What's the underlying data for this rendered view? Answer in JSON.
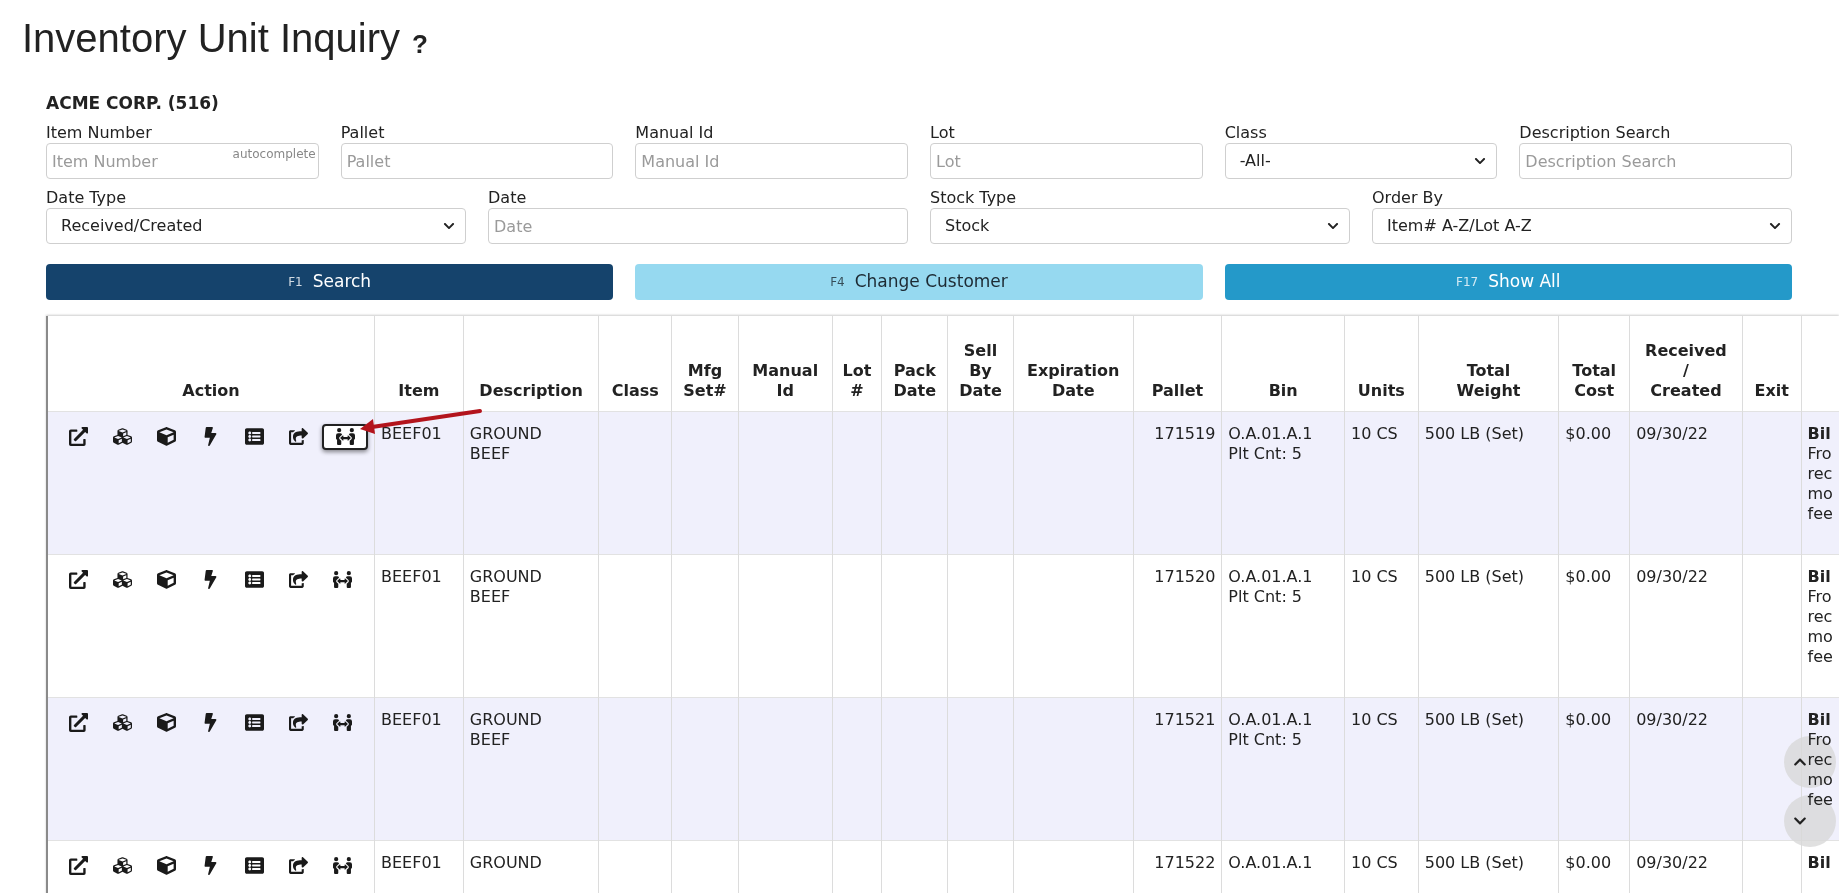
{
  "page": {
    "title": "Inventory Unit Inquiry",
    "help": "?"
  },
  "customer": "ACME CORP. (516)",
  "filters": [
    {
      "kind": "input",
      "label": "Item Number",
      "placeholder": "Item Number",
      "hint": "autocomplete"
    },
    {
      "kind": "input",
      "label": "Pallet",
      "placeholder": "Pallet"
    },
    {
      "kind": "input",
      "label": "Manual Id",
      "placeholder": "Manual Id"
    },
    {
      "kind": "input",
      "label": "Lot",
      "placeholder": "Lot"
    },
    {
      "kind": "select",
      "label": "Class",
      "value": "-All-"
    },
    {
      "kind": "input",
      "label": "Description Search",
      "placeholder": "Description Search"
    },
    {
      "kind": "select",
      "label": "Date Type",
      "value": "Received/Created"
    },
    {
      "kind": "input",
      "label": "Date",
      "placeholder": "Date"
    },
    {
      "kind": "select",
      "label": "Stock Type",
      "value": "Stock"
    },
    {
      "kind": "select",
      "label": "Order By",
      "value": "Item# A-Z/Lot A-Z"
    }
  ],
  "buttons": [
    {
      "key": "F1",
      "label": "Search"
    },
    {
      "key": "F4",
      "label": "Change Customer"
    },
    {
      "key": "F17",
      "label": "Show All"
    }
  ],
  "table": {
    "columns": [
      [
        "Action"
      ],
      [
        "Item"
      ],
      [
        "Description"
      ],
      [
        "Class"
      ],
      [
        "Mfg",
        "Set#"
      ],
      [
        "Manual",
        "Id"
      ],
      [
        "Lot",
        "#"
      ],
      [
        "Pack",
        "Date"
      ],
      [
        "Sell",
        "By",
        "Date"
      ],
      [
        "Expiration",
        "Date"
      ],
      [
        "Pallet"
      ],
      [
        "Bin"
      ],
      [
        "Units"
      ],
      [
        "Total",
        "Weight"
      ],
      [
        "Total",
        "Cost"
      ],
      [
        "Received",
        "/",
        "Created"
      ],
      [
        "Exit"
      ],
      []
    ],
    "rows": [
      {
        "actions": [
          {
            "kind": "open",
            "highlighted": false
          },
          {
            "kind": "cubes",
            "highlighted": false
          },
          {
            "kind": "cube",
            "highlighted": false
          },
          {
            "kind": "bolt",
            "highlighted": false
          },
          {
            "kind": "list",
            "highlighted": false
          },
          {
            "kind": "share",
            "highlighted": false
          },
          {
            "kind": "transfer",
            "highlighted": true
          }
        ],
        "item": "BEEF01",
        "description": [
          "GROUND",
          "BEEF"
        ],
        "pallet": "171519",
        "bin": [
          "O.A.01.A.1",
          "Plt Cnt: 5"
        ],
        "units": "10 CS",
        "total_weight": "500 LB (Set)",
        "total_cost": "$0.00",
        "received": "09/30/22",
        "note": {
          "title": "Bil",
          "lines": [
            "Fro",
            "rec",
            "mo",
            "fee"
          ]
        }
      },
      {
        "actions": [
          {
            "kind": "open",
            "highlighted": false
          },
          {
            "kind": "cubes",
            "highlighted": false
          },
          {
            "kind": "cube",
            "highlighted": false
          },
          {
            "kind": "bolt",
            "highlighted": false
          },
          {
            "kind": "list",
            "highlighted": false
          },
          {
            "kind": "share",
            "highlighted": false
          },
          {
            "kind": "transfer",
            "highlighted": false
          }
        ],
        "item": "BEEF01",
        "description": [
          "GROUND",
          "BEEF"
        ],
        "pallet": "171520",
        "bin": [
          "O.A.01.A.1",
          "Plt Cnt: 5"
        ],
        "units": "10 CS",
        "total_weight": "500 LB (Set)",
        "total_cost": "$0.00",
        "received": "09/30/22",
        "note": {
          "title": "Bil",
          "lines": [
            "Fro",
            "rec",
            "mo",
            "fee"
          ]
        }
      },
      {
        "actions": [
          {
            "kind": "open",
            "highlighted": false
          },
          {
            "kind": "cubes",
            "highlighted": false
          },
          {
            "kind": "cube",
            "highlighted": false
          },
          {
            "kind": "bolt",
            "highlighted": false
          },
          {
            "kind": "list",
            "highlighted": false
          },
          {
            "kind": "share",
            "highlighted": false
          },
          {
            "kind": "transfer",
            "highlighted": false
          }
        ],
        "item": "BEEF01",
        "description": [
          "GROUND",
          "BEEF"
        ],
        "pallet": "171521",
        "bin": [
          "O.A.01.A.1",
          "Plt Cnt: 5"
        ],
        "units": "10 CS",
        "total_weight": "500 LB (Set)",
        "total_cost": "$0.00",
        "received": "09/30/22",
        "note": {
          "title": "Bil",
          "lines": [
            "Fro",
            "rec",
            "mo",
            "fee"
          ]
        }
      },
      {
        "actions": [
          {
            "kind": "open",
            "highlighted": false
          },
          {
            "kind": "cubes",
            "highlighted": false
          },
          {
            "kind": "cube",
            "highlighted": false
          },
          {
            "kind": "bolt",
            "highlighted": false
          },
          {
            "kind": "list",
            "highlighted": false
          },
          {
            "kind": "share",
            "highlighted": false
          },
          {
            "kind": "transfer",
            "highlighted": false
          }
        ],
        "item": "BEEF01",
        "description": [
          "GROUND"
        ],
        "pallet": "171522",
        "bin": [
          "O.A.01.A.1"
        ],
        "units": "10 CS",
        "total_weight": "500 LB (Set)",
        "total_cost": "$0.00",
        "received": "09/30/22",
        "note": {
          "title": "Bil"
        }
      }
    ]
  }
}
